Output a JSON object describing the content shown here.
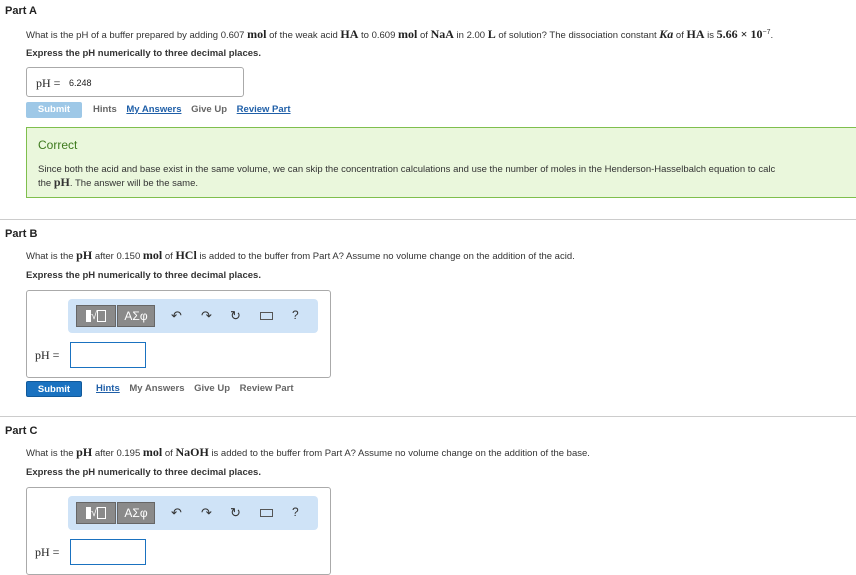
{
  "partA": {
    "title": "Part A",
    "q1": "What is the pH of a buffer prepared by adding 0.607 ",
    "q_mol1": "mol",
    "q2": " of the weak acid ",
    "q_ha": "HA",
    "q3": " to 0.609 ",
    "q_mol2": "mol",
    "q4": " of ",
    "q_naa": "NaA",
    "q5": " in 2.00 ",
    "q_l": "L",
    "q6": " of solution? The dissociation constant ",
    "q_ka": "Ka",
    "q7": " of ",
    "q_ha2": "HA",
    "q8": " is ",
    "q_val": "5.66 × 10",
    "q_exp": "−7",
    "q9": ".",
    "express": "Express the pH numerically to three decimal places.",
    "answer_label": "pH =",
    "answer_value": "6.248",
    "submit": "Submit",
    "hints": "Hints",
    "my_answers": "My Answers",
    "give_up": "Give Up",
    "review_part": "Review Part",
    "feedback_title": "Correct",
    "feedback_line1": "Since both the acid and base exist in the same volume, we can skip the concentration calculations and use the number of moles in the Henderson-Hasselbalch equation to calc",
    "feedback_line2a": "the ",
    "feedback_ph": "pH",
    "feedback_line2b": ". The answer will be the same."
  },
  "partB": {
    "title": "Part B",
    "q1": "What is the ",
    "q_ph": "pH",
    "q2": " after 0.150 ",
    "q_mol": "mol",
    "q3": " of ",
    "q_hcl": "HCl",
    "q4": " is added to the buffer from Part A? Assume no volume change on the addition of the acid.",
    "express": "Express the pH numerically to three decimal places.",
    "answer_label": "pH =",
    "submit": "Submit",
    "hints": "Hints",
    "my_answers": "My Answers",
    "give_up": "Give Up",
    "review_part": "Review Part"
  },
  "partC": {
    "title": "Part C",
    "q1": "What is the ",
    "q_ph": "pH",
    "q2": " after 0.195 ",
    "q_mol": "mol",
    "q3": " of ",
    "q_naoh": "NaOH",
    "q4": " is added to the buffer from Part A? Assume no volume change on the addition of the base.",
    "express": "Express the pH numerically to three decimal places.",
    "answer_label": "pH ="
  },
  "toolbar": {
    "greek": "ΑΣφ",
    "help": "?",
    "icons": [
      "templates-icon",
      "greek-symbols-icon",
      "undo-icon",
      "redo-icon",
      "reset-icon",
      "keyboard-icon",
      "help-icon"
    ]
  },
  "colors": {
    "submit_active": "#1a72c0",
    "submit_disabled": "#9ec8e7",
    "correct_bg": "#eaf7dc",
    "correct_border": "#7fbf4d",
    "toolbar_bg": "#cfe3f7"
  }
}
